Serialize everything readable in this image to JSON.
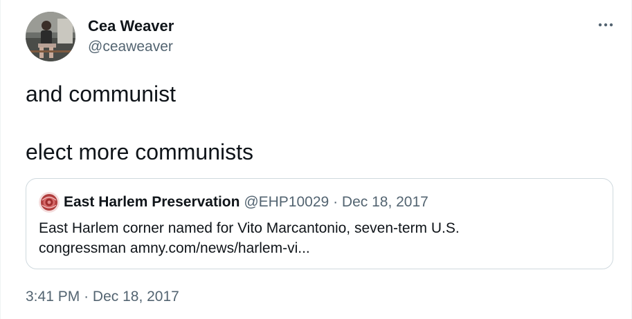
{
  "tweet": {
    "author_name": "Cea Weaver",
    "author_handle": "@ceaweaver",
    "text_line_1": "and communist",
    "text_line_2": "elect more communists",
    "timestamp": "3:41 PM",
    "separator": "·",
    "date": "Dec 18, 2017"
  },
  "quoted_tweet": {
    "author_name": "East Harlem Preservation",
    "author_handle": "@EHP10029",
    "separator": "·",
    "date": "Dec 18, 2017",
    "text_line_1": "East Harlem corner named for Vito Marcantonio, seven-term U.S.",
    "text_line_2_prefix": "congressman",
    "link_text": "amny.com/news/harlem-vi..."
  },
  "icons": {
    "more": "more-horizontal-icon",
    "author_avatar": "profile-photo",
    "quote_avatar": "rose-logo"
  },
  "colors": {
    "text_primary": "#0f1419",
    "text_secondary": "#536471",
    "border": "#cfd9de",
    "avatar_accent": "#a83a3a"
  }
}
